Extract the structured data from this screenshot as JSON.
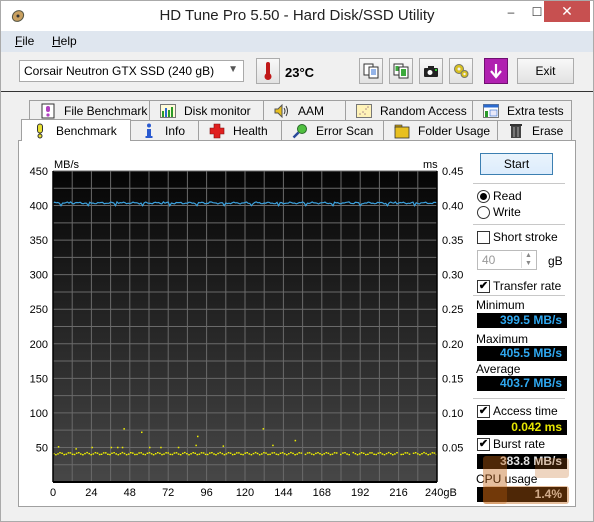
{
  "window": {
    "title": "HD Tune Pro 5.50 - Hard Disk/SSD Utility",
    "controls": {
      "minimize": "–",
      "maximize": "☐",
      "close": "✕"
    }
  },
  "menu": [
    {
      "label": "File",
      "mnemonic": "F",
      "rest": "ile"
    },
    {
      "label": "Help",
      "mnemonic": "H",
      "rest": "elp"
    }
  ],
  "toolbar": {
    "drive": "Corsair Neutron GTX SSD (240 gB)",
    "temperature": "23°C",
    "buttons": [
      "copy-text-icon",
      "copy-screenshot-icon",
      "camera-icon",
      "settings-icon",
      "save-down-icon"
    ],
    "exit_label": "Exit"
  },
  "tabs": {
    "top_row": [
      {
        "label": "File Benchmark",
        "icon": "file-benchmark-icon"
      },
      {
        "label": "Disk monitor",
        "icon": "disk-monitor-icon"
      },
      {
        "label": "AAM",
        "icon": "speaker-icon"
      },
      {
        "label": "Random Access",
        "icon": "random-access-icon"
      },
      {
        "label": "Extra tests",
        "icon": "extra-tests-icon"
      }
    ],
    "bottom_row": [
      {
        "label": "Benchmark",
        "icon": "benchmark-icon",
        "active": true
      },
      {
        "label": "Info",
        "icon": "info-icon"
      },
      {
        "label": "Health",
        "icon": "health-cross-icon"
      },
      {
        "label": "Error Scan",
        "icon": "magnifier-icon"
      },
      {
        "label": "Folder Usage",
        "icon": "folder-icon"
      },
      {
        "label": "Erase",
        "icon": "trash-icon"
      }
    ]
  },
  "controls": {
    "start_label": "Start",
    "read_label": "Read",
    "write_label": "Write",
    "mode_selected": "Read",
    "short_stroke_label": "Short stroke",
    "short_stroke_checked": false,
    "short_stroke_value": "40",
    "short_stroke_unit": "gB",
    "transfer_rate_label": "Transfer rate",
    "transfer_rate_checked": true,
    "minimum_label": "Minimum",
    "minimum_value": "399.5 MB/s",
    "maximum_label": "Maximum",
    "maximum_value": "405.5 MB/s",
    "average_label": "Average",
    "average_value": "403.7 MB/s",
    "access_time_label": "Access time",
    "access_time_checked": true,
    "access_time_value": "0.042 ms",
    "burst_rate_label": "Burst rate",
    "burst_rate_checked": true,
    "burst_rate_value": "383.8 MB/s",
    "cpu_usage_label": "CPU usage",
    "cpu_usage_value": "1.4%"
  },
  "chart_data": {
    "type": "line",
    "title": "",
    "xlabel": "gB",
    "ylabel_left": "MB/s",
    "ylabel_right": "ms",
    "xlim": [
      0,
      240
    ],
    "ylim_left": [
      0,
      450
    ],
    "ylim_right": [
      0,
      0.45
    ],
    "x_ticks": [
      "0",
      "24",
      "48",
      "72",
      "96",
      "120",
      "144",
      "168",
      "192",
      "216",
      "240gB"
    ],
    "y_ticks_left": [
      "450",
      "400",
      "350",
      "300",
      "250",
      "200",
      "150",
      "100",
      "50"
    ],
    "y_ticks_right": [
      "0.45",
      "0.40",
      "0.35",
      "0.30",
      "0.25",
      "0.20",
      "0.15",
      "0.10",
      "0.05"
    ],
    "grid": true,
    "series": [
      {
        "name": "Transfer rate",
        "axis": "left",
        "color": "#3ca0dc",
        "style": "line",
        "mean": 403.7,
        "min": 399.5,
        "max": 405.5
      },
      {
        "name": "Access time",
        "axis": "right",
        "color": "#f0f000",
        "style": "scatter",
        "mean": 0.042,
        "outliers": [
          [
            3,
            0.052
          ],
          [
            14,
            0.049
          ],
          [
            24,
            0.051
          ],
          [
            36,
            0.051
          ],
          [
            40,
            0.051
          ],
          [
            43,
            0.051
          ],
          [
            44,
            0.078
          ],
          [
            55,
            0.073
          ],
          [
            60,
            0.051
          ],
          [
            67,
            0.051
          ],
          [
            78,
            0.051
          ],
          [
            89,
            0.054
          ],
          [
            90,
            0.067
          ],
          [
            106,
            0.053
          ],
          [
            131,
            0.078
          ],
          [
            137,
            0.054
          ],
          [
            151,
            0.061
          ]
        ]
      }
    ]
  }
}
